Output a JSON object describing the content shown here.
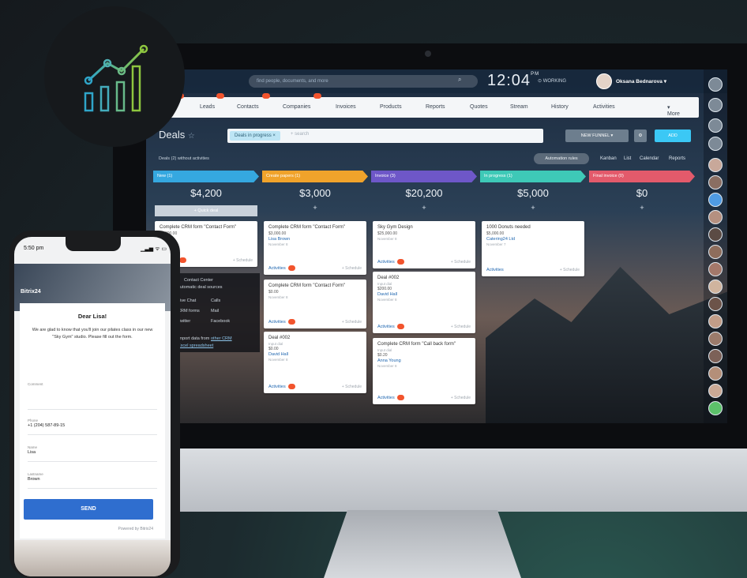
{
  "topbar": {
    "search_placeholder": "find people, documents, and more",
    "clock": "12:04",
    "clock_suffix": "PM",
    "status": "WORKING",
    "user": "Oksana Bednarova"
  },
  "nav": [
    "Leads",
    "Contacts",
    "Companies",
    "Invoices",
    "Products",
    "Reports",
    "Quotes",
    "Stream",
    "History",
    "Activities",
    "More"
  ],
  "nav_badges": {
    "Leads": "1",
    "Contacts": "1",
    "Companies": "1"
  },
  "deals": {
    "title": "Deals",
    "filter": "Deals in progress",
    "search": "+ search",
    "funnel": "NEW FUNNEL",
    "add": "ADD",
    "without": "Deals",
    "without_count": "2",
    "without_text": "without activities",
    "automation": "Automation rules",
    "views": [
      "Kanban",
      "List",
      "Calendar",
      "Reports"
    ]
  },
  "columns": [
    {
      "name": "New (1)",
      "sum": "$4,200",
      "color": "#35a8e0",
      "quick": "+ Quick deal"
    },
    {
      "name": "Create papers (1)",
      "sum": "$3,000",
      "color": "#f0a32b"
    },
    {
      "name": "Invoice (3)",
      "sum": "$20,200",
      "color": "#6e57c8"
    },
    {
      "name": "In progress (1)",
      "sum": "$5,000",
      "color": "#3ec9b7"
    },
    {
      "name": "Final invoice (0)",
      "sum": "$0",
      "color": "#e35a6b"
    }
  ],
  "cards": [
    {
      "title": "Complete CRM form \"Contact Form\"",
      "amount": "$4,200.00",
      "link": "",
      "date": ""
    },
    {
      "title": "Complete CRM form \"Contact Form\"",
      "amount": "$3,000.00",
      "link": "Lisa Brown",
      "date": "November 8"
    },
    {
      "title": "Complete CRM form \"Contact Form\"",
      "amount": "$0.00",
      "link": "",
      "date": "November 8"
    },
    {
      "title": "Deal #002",
      "amount": "$0.00",
      "link": "David Hall",
      "date": "November 8",
      "sub": "Input dial"
    },
    {
      "title": "Sky Gym Design",
      "amount": "$25,000.00",
      "link": "",
      "date": "November 8"
    },
    {
      "title": "Deal #002",
      "amount": "$200.00",
      "link": "David Hall",
      "date": "November 8",
      "sub": "Input dial"
    },
    {
      "title": "Complete CRM form \"Call back form\"",
      "amount": "$0.20",
      "link": "Anna Young",
      "date": "November 8",
      "sub": "Input dial"
    },
    {
      "title": "1000 Donuts needed",
      "amount": "$5,000.00",
      "link": "Catering24 Ltd",
      "date": "November 7"
    }
  ],
  "card_labels": {
    "activities": "Activities",
    "schedule": "+ Schedule"
  },
  "overlay": {
    "title": "Contact Center",
    "subtitle": "automatic deal sources",
    "items": [
      "Live Chat",
      "Calls",
      "CRM forms",
      "Mail",
      "Twitter",
      "Facebook"
    ],
    "import_text": "Import data from",
    "link1": "other CRM",
    "or": "or",
    "link2": "Excel spreadsheet"
  },
  "phone": {
    "time": "5:50 pm",
    "status": "▁▃▅ ᯤ ▭",
    "brand": "Bitrix24",
    "greeting": "Dear Lisa!",
    "message": "We are glad to know that you'll join our pilates class in our new \"Sky Gym\" studio. Please fill out the form.",
    "fields": [
      {
        "label": "Comment",
        "value": ""
      },
      {
        "label": "Phone",
        "value": "+1 (204) 587-89-15"
      },
      {
        "label": "Name",
        "value": "Lisa"
      },
      {
        "label": "Lastname",
        "value": "Brown"
      }
    ],
    "send": "SEND",
    "powered": "Powered by Bitrix24"
  },
  "colors": {
    "accent": "#2f6ecf",
    "badge_line": "#2fa5c9",
    "badge_line2": "#8ec63f"
  }
}
